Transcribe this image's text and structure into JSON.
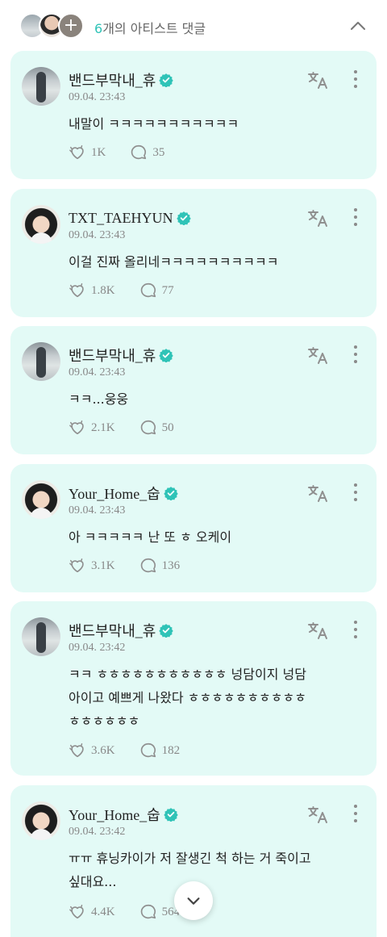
{
  "header": {
    "count": "6",
    "title_suffix": "개의 아티스트 댓글",
    "collapse_icon": "chevron-up-icon"
  },
  "icons": {
    "verified": "verified-badge-icon",
    "translate": "translate-icon",
    "more": "more-vertical-icon",
    "like": "like-heart-icon",
    "reply": "reply-bubble-icon",
    "scroll": "chevron-down-icon"
  },
  "colors": {
    "accent": "#2fc3b7",
    "card_bg": "#e3faf6"
  },
  "comments": [
    {
      "author": "밴드부막내_휴",
      "time": "09.04. 23:43",
      "text": "내말이 ㅋㅋㅋㅋㅋㅋㅋㅋㅋㅋㅋ",
      "likes": "1K",
      "replies": "35"
    },
    {
      "author": "TXT_TAEHYUN",
      "time": "09.04. 23:43",
      "text": "이걸 진짜 올리네ㅋㅋㅋㅋㅋㅋㅋㅋㅋㅋ",
      "likes": "1.8K",
      "replies": "77"
    },
    {
      "author": "밴드부막내_휴",
      "time": "09.04. 23:43",
      "text": "ㅋㅋ...웅웅",
      "likes": "2.1K",
      "replies": "50"
    },
    {
      "author": "Your_Home_숩",
      "time": "09.04. 23:43",
      "text": "아 ㅋㅋㅋㅋㅋ 난 또 ㅎ 오케이",
      "likes": "3.1K",
      "replies": "136"
    },
    {
      "author": "밴드부막내_휴",
      "time": "09.04. 23:42",
      "text": "ㅋㅋ ㅎㅎㅎㅎㅎㅎㅎㅎㅎㅎㅎ 넝담이지 넝담\n아이고 예쁘게 나왔다 ㅎㅎㅎㅎㅎㅎㅎㅎㅎㅎ\nㅎㅎㅎㅎㅎㅎ",
      "likes": "3.6K",
      "replies": "182"
    },
    {
      "author": "Your_Home_숩",
      "time": "09.04. 23:42",
      "text": "ㅠㅠ 휴닝카이가 저 잘생긴 척 하는 거 죽이고\n싶대요...",
      "likes": "4.4K",
      "replies": "564"
    }
  ]
}
